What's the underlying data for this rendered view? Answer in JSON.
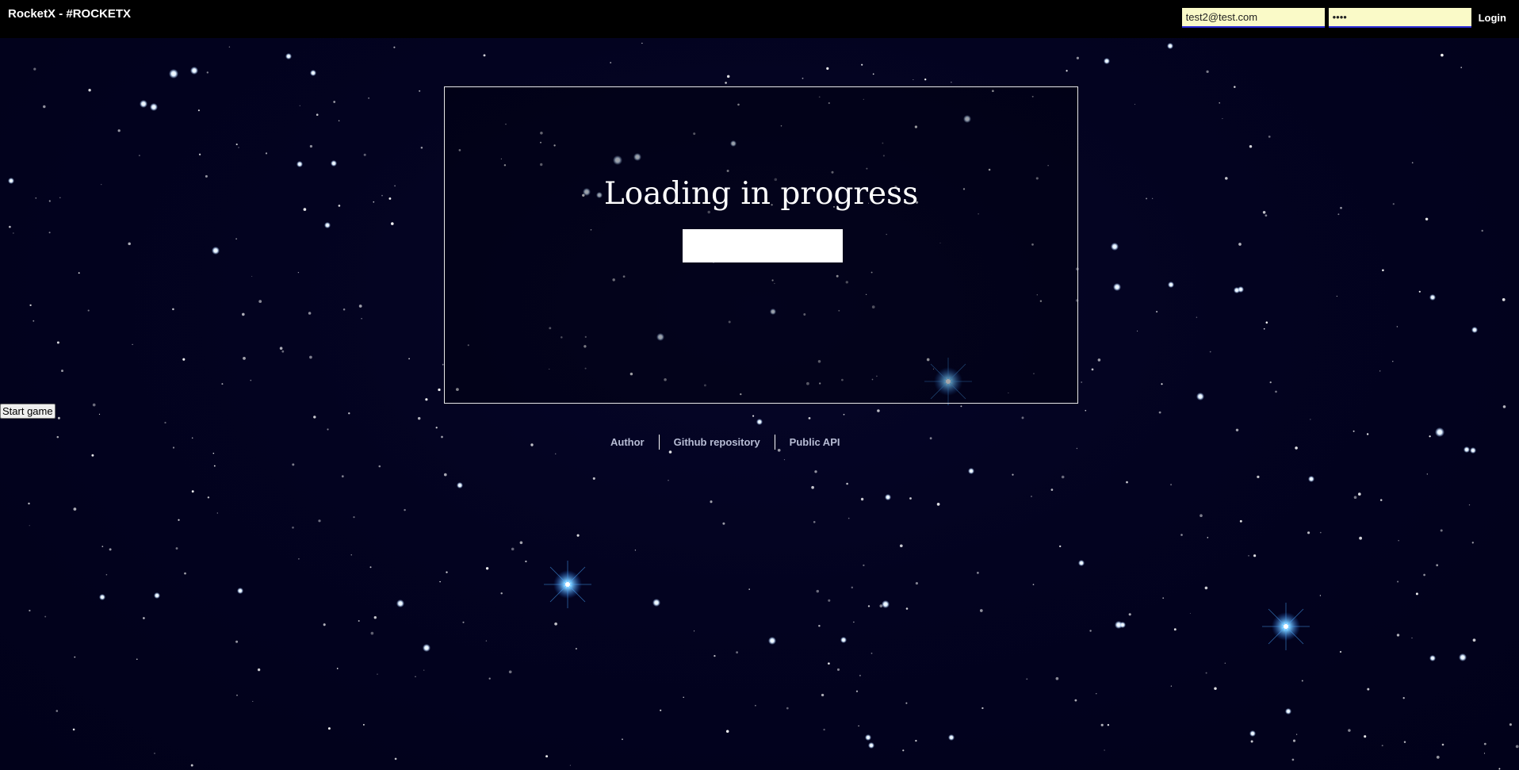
{
  "header": {
    "title": "RocketX - #ROCKETX",
    "login": {
      "email_value": "test2@test.com",
      "password_value": "••••",
      "login_label": "Login"
    }
  },
  "main": {
    "loading_title": "Loading in progress",
    "progress_fraction": 1.0,
    "start_game_label": "Start game"
  },
  "footer": {
    "links": [
      {
        "label": "Author"
      },
      {
        "label": "Github repository"
      },
      {
        "label": "Public API"
      }
    ]
  },
  "colors": {
    "background": "#02021a",
    "topbar": "#000000",
    "input_background": "#fafac8",
    "input_underline": "#2b2bd9",
    "footer_link": "#b7bcd4"
  }
}
